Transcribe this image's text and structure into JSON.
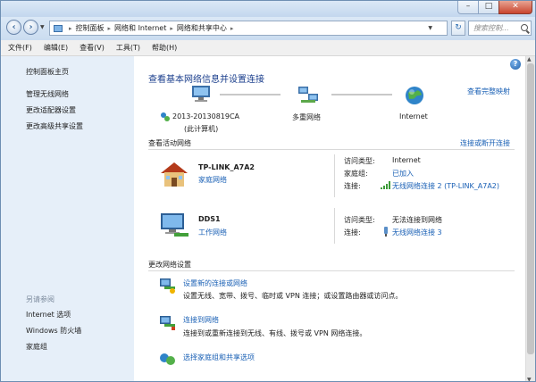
{
  "address": {
    "crumbs": [
      "控制面板",
      "网络和 Internet",
      "网络和共享中心"
    ],
    "search_placeholder": "搜索控制..."
  },
  "menu": [
    "文件(F)",
    "编辑(E)",
    "查看(V)",
    "工具(T)",
    "帮助(H)"
  ],
  "sidebar": {
    "links": [
      "控制面板主页",
      "管理无线网络",
      "更改适配器设置",
      "更改高级共享设置"
    ],
    "see_also_title": "另请参阅",
    "see_also": [
      "Internet 选项",
      "Windows 防火墙",
      "家庭组"
    ]
  },
  "main": {
    "title": "查看基本网络信息并设置连接",
    "see_full_map": "查看完整映射",
    "map": {
      "computer_name": "2013-20130819CA",
      "computer_sub": "(此计算机)",
      "middle": "多重网络",
      "internet": "Internet"
    },
    "active_header": "查看活动网络",
    "connect_disconnect": "连接或断开连接",
    "networks": [
      {
        "name": "TP-LINK_A7A2",
        "type": "家庭网络",
        "access_label": "访问类型:",
        "access_value": "Internet",
        "home_label": "家庭组:",
        "home_value": "已加入",
        "conn_label": "连接:",
        "conn_value": "无线网络连接 2 (TP-LINK_A7A2)"
      },
      {
        "name": "DDS1",
        "type": "工作网络",
        "access_label": "访问类型:",
        "access_value": "无法连接到网络",
        "conn_label": "连接:",
        "conn_value": "无线网络连接 3"
      }
    ],
    "change_header": "更改网络设置",
    "tasks": [
      {
        "title": "设置新的连接或网络",
        "desc": "设置无线、宽带、拨号、临时或 VPN 连接；或设置路由器或访问点。"
      },
      {
        "title": "连接到网络",
        "desc": "连接到或重新连接到无线、有线、拨号或 VPN 网络连接。"
      },
      {
        "title": "选择家庭组和共享选项",
        "desc": ""
      }
    ]
  },
  "colors": {
    "link": "#1a60b5",
    "title": "#1a3e8c",
    "sidebar_bg": "#e6eff9"
  }
}
